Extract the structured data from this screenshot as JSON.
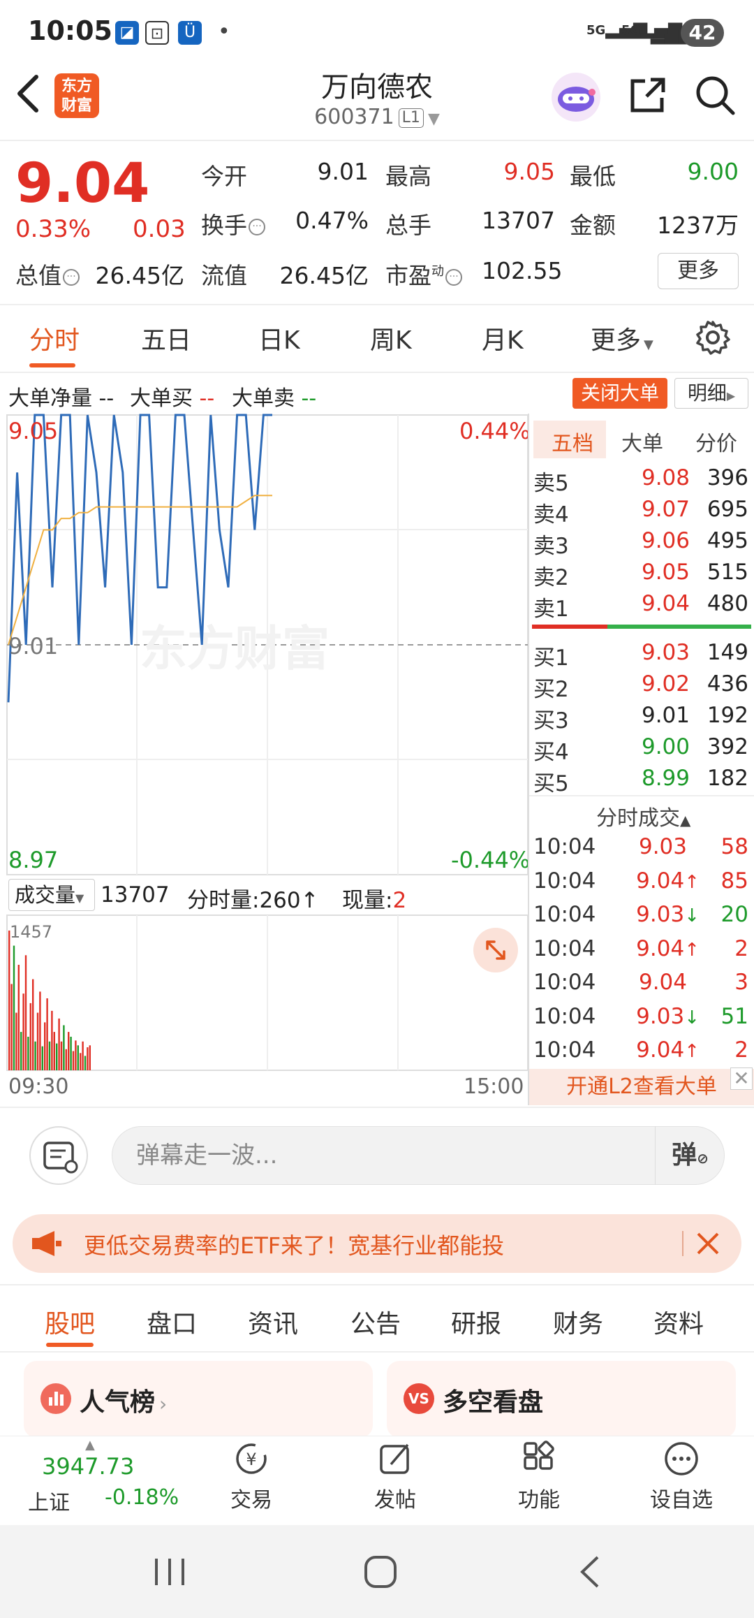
{
  "status_bar": {
    "time": "10:05",
    "battery": "42",
    "net1": "5G",
    "net2": "5G"
  },
  "header": {
    "back": "‹",
    "logo_line1": "东方",
    "logo_line2": "财富",
    "title": "万向德农",
    "code": "600371",
    "level": "L1"
  },
  "quote": {
    "price": "9.04",
    "pct": "0.33%",
    "change": "0.03",
    "rows": [
      [
        {
          "label": "今开",
          "value": "9.01",
          "color": "#222"
        },
        {
          "label": "最高",
          "value": "9.05",
          "color": "#e02e24"
        },
        {
          "label": "最低",
          "value": "9.00",
          "color": "#1d9a2a"
        }
      ],
      [
        {
          "label": "换手",
          "value": "0.47%",
          "color": "#222"
        },
        {
          "label": "总手",
          "value": "13707",
          "color": "#222"
        },
        {
          "label": "金额",
          "value": "1237万",
          "color": "#222"
        }
      ]
    ],
    "total_value_label": "总值",
    "total_value": "26.45亿",
    "float_value_label": "流值",
    "float_value": "26.45亿",
    "pe_label": "市盈",
    "pe_sup": "动",
    "pe_value": "102.55",
    "more": "更多"
  },
  "chart_tabs": [
    "分时",
    "五日",
    "日K",
    "周K",
    "月K",
    "更多"
  ],
  "order_flow": {
    "net_label": "大单净量",
    "net_val": "--",
    "buy_label": "大单买",
    "buy_val": "--",
    "sell_label": "大单卖",
    "sell_val": "--",
    "close_btn": "关闭大单",
    "detail_btn": "明细"
  },
  "chart": {
    "price_high": "9.05",
    "pct_high": "0.44%",
    "price_mid": "9.01",
    "price_low": "8.97",
    "pct_low": "-0.44%",
    "watermark": "东方财富",
    "vol_selector": "成交量",
    "vol_total": "13707",
    "vol_minute_label": "分时量:",
    "vol_minute": "260",
    "vol_now_label": "现量:",
    "vol_now": "2",
    "vol_max": "1457",
    "time_start": "09:30",
    "time_end": "15:00"
  },
  "chart_data": {
    "type": "line",
    "ylim": [
      8.97,
      9.05
    ],
    "series": [
      {
        "values": [
          9.0,
          9.04,
          9.01,
          9.05,
          9.05,
          9.02,
          9.05,
          9.05,
          9.01,
          9.05,
          9.04,
          9.02,
          9.05,
          9.04,
          9.01,
          9.05,
          9.05,
          9.02,
          9.02,
          9.05,
          9.05,
          9.03,
          9.01,
          9.05,
          9.03,
          9.02,
          9.05,
          9.05,
          9.03,
          9.05,
          9.05
        ]
      },
      {
        "values": [
          9.01,
          9.015,
          9.02,
          9.025,
          9.03,
          9.03,
          9.032,
          9.032,
          9.033,
          9.033,
          9.034,
          9.034,
          9.034,
          9.034,
          9.034,
          9.034,
          9.034,
          9.034,
          9.034,
          9.034,
          9.034,
          9.034,
          9.034,
          9.034,
          9.034,
          9.034,
          9.034,
          9.035,
          9.036,
          9.036,
          9.036
        ]
      }
    ],
    "volume": [
      1457,
      900,
      1300,
      600,
      1100,
      400,
      800,
      1200,
      350,
      700,
      950,
      300,
      600,
      820,
      250,
      500,
      750,
      300,
      620,
      400,
      280,
      540,
      300,
      470,
      220,
      400,
      350,
      200,
      310,
      260,
      180,
      300,
      150,
      240,
      260
    ]
  },
  "panel": {
    "tabs": [
      "五档",
      "大单",
      "分价"
    ],
    "asks": [
      {
        "label": "卖5",
        "price": "9.08",
        "qty": "396"
      },
      {
        "label": "卖4",
        "price": "9.07",
        "qty": "695"
      },
      {
        "label": "卖3",
        "price": "9.06",
        "qty": "495"
      },
      {
        "label": "卖2",
        "price": "9.05",
        "qty": "515"
      },
      {
        "label": "卖1",
        "price": "9.04",
        "qty": "480"
      }
    ],
    "bids": [
      {
        "label": "买1",
        "price": "9.03",
        "qty": "149"
      },
      {
        "label": "买2",
        "price": "9.02",
        "qty": "436"
      },
      {
        "label": "买3",
        "price": "9.01",
        "qty": "192"
      },
      {
        "label": "买4",
        "price": "9.00",
        "qty": "392"
      },
      {
        "label": "买5",
        "price": "8.99",
        "qty": "182"
      }
    ],
    "trades_title": "分时成交",
    "trades": [
      {
        "time": "10:04",
        "price": "9.03",
        "arrow": "",
        "qty": "58",
        "pc": "#e02e24",
        "qc": "#e02e24"
      },
      {
        "time": "10:04",
        "price": "9.04",
        "arrow": "↑",
        "qty": "85",
        "pc": "#e02e24",
        "qc": "#e02e24"
      },
      {
        "time": "10:04",
        "price": "9.03",
        "arrow": "↓",
        "qty": "20",
        "pc": "#e02e24",
        "qc": "#1d9a2a"
      },
      {
        "time": "10:04",
        "price": "9.04",
        "arrow": "↑",
        "qty": "2",
        "pc": "#e02e24",
        "qc": "#e02e24"
      },
      {
        "time": "10:04",
        "price": "9.04",
        "arrow": "",
        "qty": "3",
        "pc": "#e02e24",
        "qc": "#e02e24"
      },
      {
        "time": "10:04",
        "price": "9.03",
        "arrow": "↓",
        "qty": "51",
        "pc": "#e02e24",
        "qc": "#1d9a2a"
      },
      {
        "time": "10:04",
        "price": "9.04",
        "arrow": "↑",
        "qty": "2",
        "pc": "#e02e24",
        "qc": "#e02e24"
      }
    ],
    "l2_banner": "开通L2查看大单"
  },
  "comment": {
    "placeholder": "弹幕走一波...",
    "danmu": "弹"
  },
  "ad": {
    "text": "更低交易费率的ETF来了！宽基行业都能投"
  },
  "bottom_tabs": [
    "股吧",
    "盘口",
    "资讯",
    "公告",
    "研报",
    "财务",
    "资料"
  ],
  "cards": [
    {
      "title": "人气榜",
      "icon": "ranking-icon"
    },
    {
      "title": "多空看盘",
      "icon": "vs-icon"
    }
  ],
  "bottom_nav": {
    "index_value": "3947.73",
    "index_name": "上证",
    "index_change": "-0.18%",
    "items": [
      "交易",
      "发帖",
      "功能",
      "设自选"
    ]
  }
}
